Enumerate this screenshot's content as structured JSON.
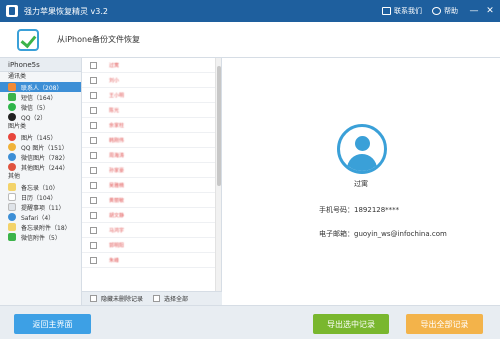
{
  "titlebar": {
    "title": "强力苹果恢复精灵 v3.2",
    "contact_label": "联系我们",
    "help_label": "帮助",
    "min_glyph": "—",
    "close_glyph": "✕"
  },
  "subheader": {
    "title": "从iPhone备份文件恢复"
  },
  "sidebar": {
    "device": "iPhone5s",
    "groups": [
      {
        "label": "通讯类",
        "items": [
          {
            "label": "联系人（208）",
            "color": "#f28a35",
            "icon": "contacts-icon"
          },
          {
            "label": "短信（164）",
            "color": "#3cb34a",
            "icon": "sms-icon"
          },
          {
            "label": "微信（5）",
            "color": "#2fb54a",
            "icon": "wechat-icon"
          },
          {
            "label": "QQ（2）",
            "color": "#222222",
            "icon": "qq-icon"
          }
        ]
      },
      {
        "label": "图片类",
        "items": [
          {
            "label": "图片（145）",
            "color": "#e8463c",
            "icon": "photos-icon"
          },
          {
            "label": "QQ 图片（151）",
            "color": "#f0b23a",
            "icon": "qq-photos-icon"
          },
          {
            "label": "微信图片（782）",
            "color": "#3d8fd6",
            "icon": "wechat-photos-icon"
          },
          {
            "label": "其他图片（244）",
            "color": "#e0533f",
            "icon": "other-photos-icon"
          }
        ]
      },
      {
        "label": "其他",
        "items": [
          {
            "label": "备忘录（10）",
            "color": "#f3d36a",
            "icon": "notes-icon"
          },
          {
            "label": "日历（104）",
            "color": "#ffffff",
            "icon": "calendar-icon"
          },
          {
            "label": "提醒事项（11）",
            "color": "#dfe3e8",
            "icon": "reminders-icon"
          },
          {
            "label": "Safari（4）",
            "color": "#3d8fd6",
            "icon": "safari-icon"
          },
          {
            "label": "备忘录附件（18）",
            "color": "#f3d36a",
            "icon": "notes-attachments-icon"
          },
          {
            "label": "微信附件（5）",
            "color": "#3cb34a",
            "icon": "wechat-attachments-icon"
          }
        ]
      }
    ]
  },
  "list": {
    "rows": [
      "过寓",
      "刘小",
      "王小明",
      "陈光",
      "余家柱",
      "韩刚伟",
      "周海涛",
      "孙家豪",
      "吴雅楠",
      "黄丽敏",
      "胡文静",
      "马鸿宇",
      "郭明阳",
      "朱峰"
    ],
    "footer_hide_deleted": "隐藏未删除记录",
    "footer_select_all": "选择全部"
  },
  "detail": {
    "name": "过寓",
    "phone_label": "手机号码：",
    "phone_value": "1892128****",
    "email_label": "电子邮箱：",
    "email_value": "guoyin_ws@infochina.com"
  },
  "footer": {
    "back_label": "返回主界面",
    "export_selected_label": "导出选中记录",
    "export_all_label": "导出全部记录"
  }
}
